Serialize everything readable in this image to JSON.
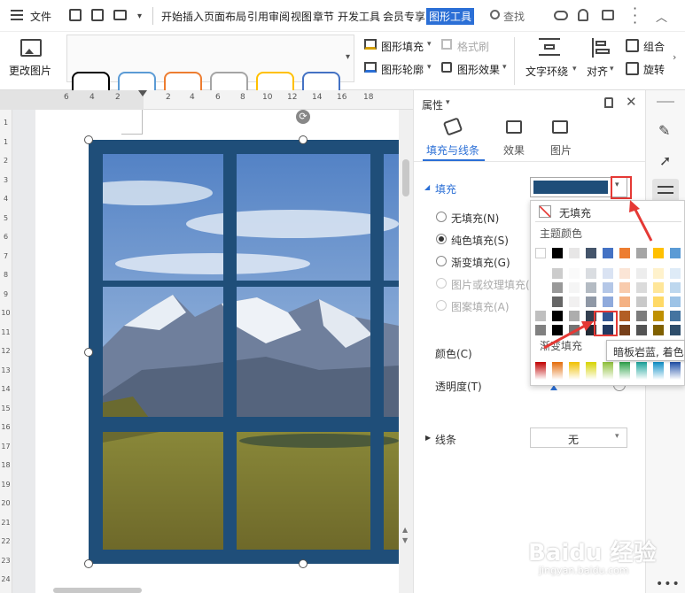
{
  "menubar": {
    "file_label": "文件",
    "tabs": [
      "开始",
      "插入",
      "页面布局",
      "引用",
      "审阅",
      "视图",
      "章节",
      "开发工具",
      "会员专享",
      "图形工具"
    ],
    "search_label": "查找"
  },
  "ribbon": {
    "change_picture_label": "更改图片",
    "shape_fill_label": "图形填充",
    "format_brush_label": "格式刷",
    "shape_outline_label": "图形轮廓",
    "shape_effect_label": "图形效果",
    "text_wrap_label": "文字环绕",
    "align_label": "对齐",
    "group_label": "组合",
    "rotate_label": "旋转",
    "style_swatch_colors": [
      "#000000",
      "#5b9bd5",
      "#ed7d31",
      "#a5a5a5",
      "#ffc000",
      "#4472c4"
    ]
  },
  "ruler": {
    "h_ticks": [
      "6",
      "4",
      "2",
      "2",
      "4",
      "6",
      "8",
      "10",
      "12",
      "14",
      "16",
      "18"
    ],
    "v_ticks": [
      "1",
      "1",
      "2",
      "3",
      "4",
      "5",
      "6",
      "7",
      "8",
      "9",
      "10",
      "11",
      "12",
      "13",
      "14",
      "15",
      "16",
      "17",
      "18",
      "19",
      "20",
      "21",
      "22",
      "23",
      "24"
    ]
  },
  "panel": {
    "title": "属性",
    "tabs": [
      "填充与线条",
      "效果",
      "图片"
    ],
    "fill_section": "填充",
    "fill_options": [
      "无填充(N)",
      "纯色填充(S)",
      "渐变填充(G)",
      "图片或纹理填充(",
      "图案填充(A)"
    ],
    "color_label": "颜色(C)",
    "transparency_label": "透明度(T)",
    "line_section": "线条",
    "line_value": "无",
    "current_fill_color": "#1f4e79"
  },
  "dropdown": {
    "no_fill_label": "无填充",
    "theme_colors_label": "主题颜色",
    "gradient_label": "渐变填充",
    "tooltip": "暗板岩蓝, 着色 1",
    "theme_top_row": [
      "#ffffff",
      "#000000",
      "#e7e6e6",
      "#44546a",
      "#4472c4",
      "#ed7d31",
      "#a5a5a5",
      "#ffc000",
      "#5b9bd5",
      "#70ad47"
    ],
    "gradient_colors": [
      "#c00000",
      "#e46c0a",
      "#f0c000",
      "#d6d300",
      "#8ec03a",
      "#2ea24a",
      "#1aa39a",
      "#0e8fc7",
      "#1f4fa8",
      "#6d2fa0"
    ]
  },
  "watermark": {
    "brand": "Baidu 经验",
    "url": "jingyan.baidu.com"
  },
  "colors": {
    "window_frame": "#1f4e79",
    "accent": "#2b6fd6",
    "highlight_red": "#e53935"
  }
}
